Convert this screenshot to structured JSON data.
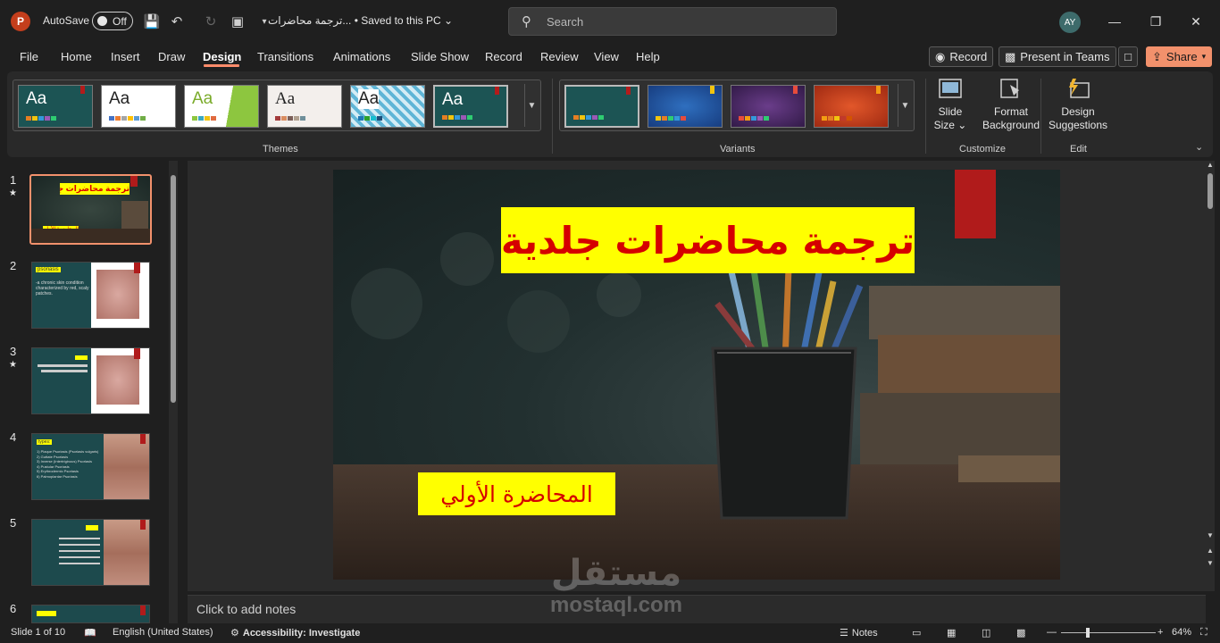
{
  "titlebar": {
    "app_logo": "P",
    "autosave_label": "AutoSave",
    "autosave_state": "Off",
    "doc_title": "ترجمة محاضرات... • Saved to this PC ⌄",
    "search_placeholder": "Search",
    "user_initials": "AY",
    "icons": [
      "save-icon",
      "undo-icon",
      "redo-icon",
      "present-icon",
      "customize-qat-icon",
      "minimize-icon",
      "restore-icon",
      "close-icon"
    ]
  },
  "menu": {
    "tabs": [
      "File",
      "Home",
      "Insert",
      "Draw",
      "Design",
      "Transitions",
      "Animations",
      "Slide Show",
      "Record",
      "Review",
      "View",
      "Help"
    ],
    "active": "Design",
    "record_btn": "Record",
    "teams_btn": "Present in Teams",
    "share_btn": "Share"
  },
  "ribbon": {
    "themes_label": "Themes",
    "variants_label": "Variants",
    "customize_label": "Customize",
    "edit_label": "Edit",
    "theme_text": "Aa",
    "slide_size": "Slide Size",
    "format_background": [
      "Format",
      "Background"
    ],
    "design_suggestions": [
      "Design",
      "Suggestions"
    ],
    "slide_size_lines": [
      "Slide",
      "Size ⌄"
    ]
  },
  "slides_panel": {
    "numbers": [
      "1",
      "2",
      "3",
      "4",
      "5",
      "6"
    ],
    "thumb2_head": "psoriasis",
    "thumb2_text": "-a chronic skin condition characterized by red, scaly patches.",
    "thumb4_head": "types:",
    "thumb4_items": [
      "1) Plaque Psoriasis (Psoriasis vulgaris)",
      "2) Guttate Psoriasis",
      "3) Inverse (Intertriginous) Psoriasis",
      "4) Pustular Psoriasis",
      "5) Erythrodermic Psoriasis",
      "6) Palmoplantar Psoriasis"
    ]
  },
  "slide": {
    "title": "ترجمة محاضرات جلدية",
    "subtitle": "المحاضرة الأولي"
  },
  "notes_placeholder": "Click to add notes",
  "watermark": {
    "arabic": "مستقل",
    "latin": "mostaql.com"
  },
  "status": {
    "slide_count": "Slide 1 of 10",
    "language": "English (United States)",
    "accessibility": "Accessibility: Investigate",
    "notes": "Notes",
    "zoom": "64%"
  },
  "colors": {
    "accent": "#f2916c",
    "title_red": "#d50000",
    "highlight_yellow": "#ffff00"
  }
}
